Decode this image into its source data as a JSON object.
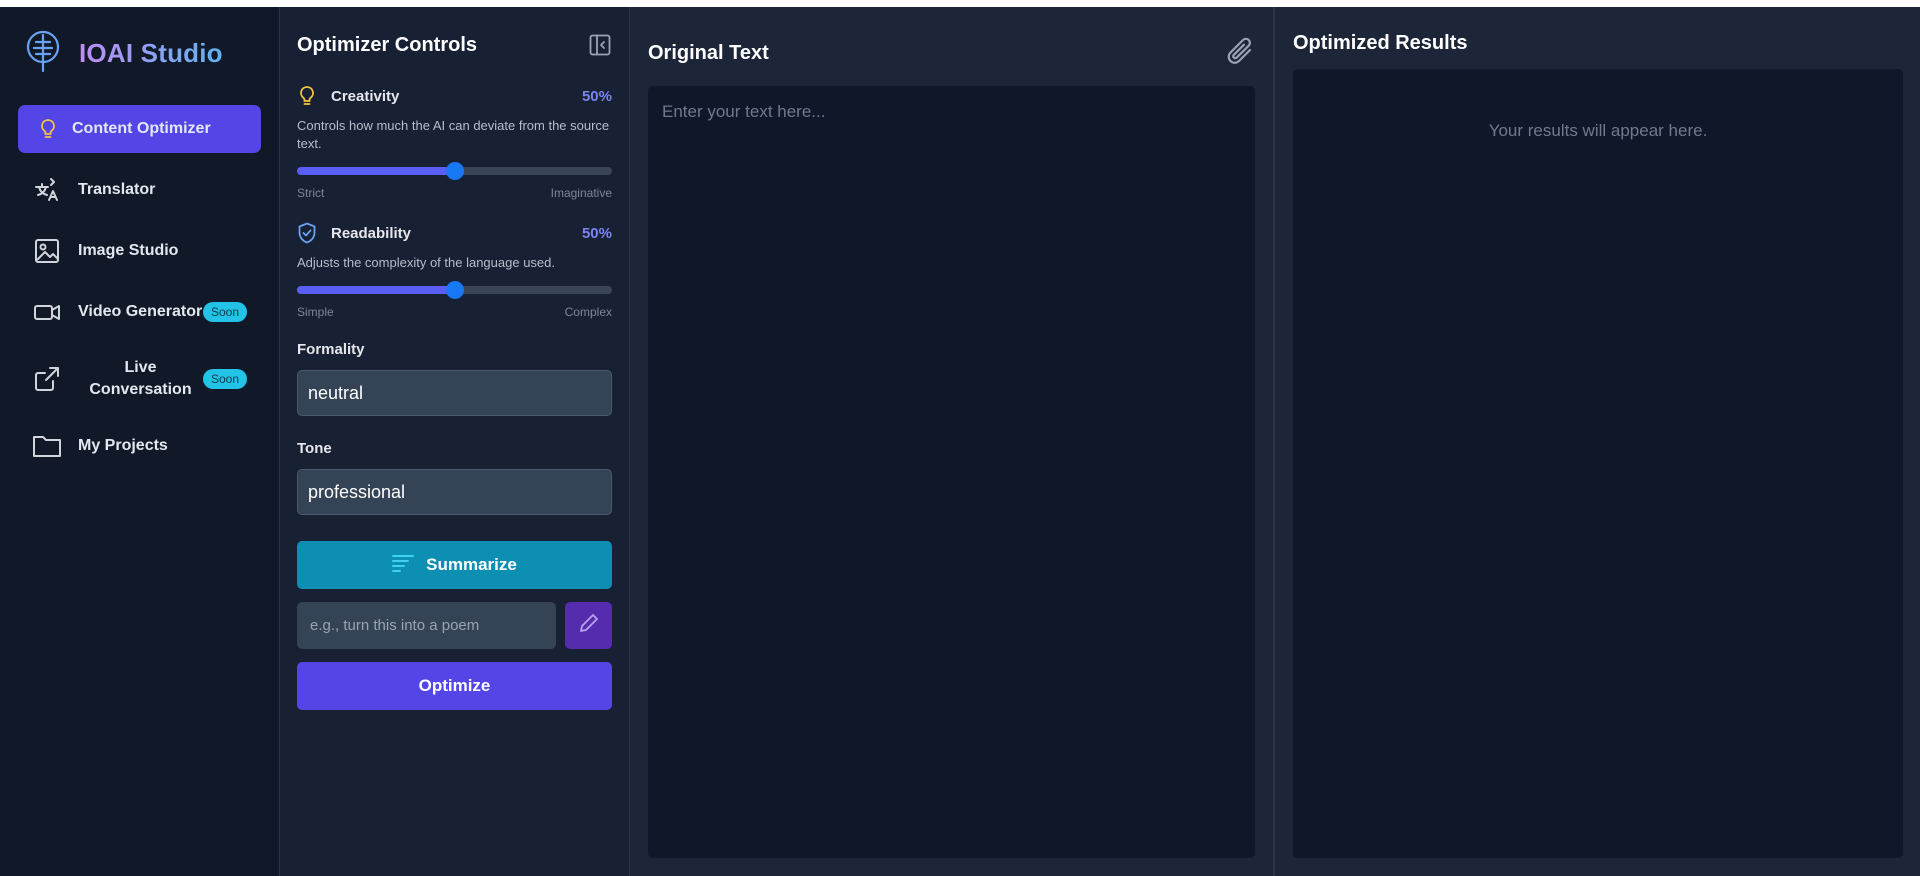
{
  "brand": {
    "title": "IOAI Studio",
    "logo_icon": "tree-logo-icon"
  },
  "sidebar": {
    "items": [
      {
        "label": "Content Optimizer",
        "icon": "lightbulb-icon",
        "active": true
      },
      {
        "label": "Translator",
        "icon": "translate-icon"
      },
      {
        "label": "Image Studio",
        "icon": "image-icon"
      },
      {
        "label": "Video Generator",
        "icon": "video-camera-icon",
        "badge": "Soon"
      },
      {
        "label": "Live Conversation",
        "icon": "share-arrow-icon",
        "badge": "Soon"
      },
      {
        "label": "My Projects",
        "icon": "folder-icon"
      }
    ]
  },
  "controls": {
    "title": "Optimizer Controls",
    "creativity": {
      "label": "Creativity",
      "value_text": "50%",
      "value": 0.5,
      "description": "Controls how much the AI can deviate from the source text.",
      "min_label": "Strict",
      "max_label": "Imaginative"
    },
    "readability": {
      "label": "Readability",
      "value_text": "50%",
      "value": 0.5,
      "description": "Adjusts the complexity of the language used.",
      "min_label": "Simple",
      "max_label": "Complex"
    },
    "formality": {
      "label": "Formality",
      "value": "neutral"
    },
    "tone": {
      "label": "Tone",
      "value": "professional"
    },
    "summarize_label": "Summarize",
    "custom_instruction_placeholder": "e.g., turn this into a poem",
    "optimize_label": "Optimize"
  },
  "original": {
    "title": "Original Text",
    "placeholder": "Enter your text here..."
  },
  "results": {
    "title": "Optimized Results",
    "empty_text": "Your results will appear here."
  },
  "colors": {
    "accent": "#5445e6",
    "summarize": "#0c8fb3",
    "badge": "#22c3e6",
    "slider_thumb": "#1877f2"
  }
}
